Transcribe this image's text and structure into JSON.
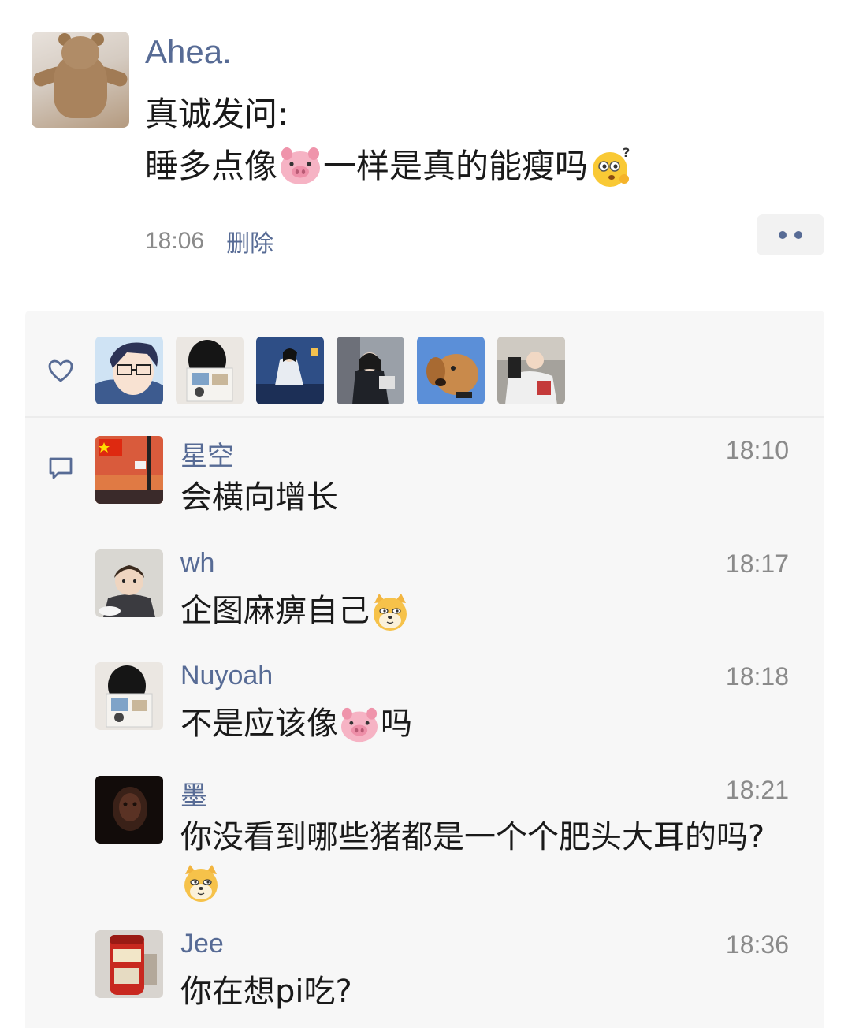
{
  "post": {
    "author": "Ahea.",
    "line1": "真诚发问:",
    "line2_before": "睡多点像",
    "line2_after": "一样是真的能瘦吗",
    "time": "18:06",
    "delete_label": "删除"
  },
  "comments": [
    {
      "name": "星空",
      "time": "18:10",
      "text": "会横向增长"
    },
    {
      "name": "wh",
      "time": "18:17",
      "text": "企图麻痹自己"
    },
    {
      "name": "Nuyoah",
      "time": "18:18",
      "text_before": "不是应该像",
      "text_after": "吗"
    },
    {
      "name": "墨",
      "time": "18:21",
      "text": "你没看到哪些猪都是一个个肥头大耳的吗?"
    },
    {
      "name": "Jee",
      "time": "18:36",
      "text": "你在想pi吃?"
    }
  ],
  "colors": {
    "link": "#576b95",
    "panel_bg": "#f7f7f7",
    "timestamp": "#8a8a8a"
  },
  "icons": [
    "heart-icon",
    "comment-icon",
    "more-icon",
    "pig-emoji",
    "doge-emoji",
    "thinking-emoji"
  ]
}
